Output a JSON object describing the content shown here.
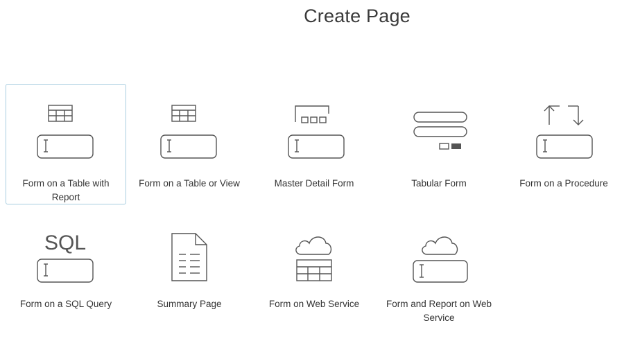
{
  "page": {
    "title": "Create Page"
  },
  "tiles": [
    {
      "label": "Form on a Table with Report",
      "icon": "form-table-report-icon",
      "selected": true
    },
    {
      "label": "Form on a Table or View",
      "icon": "form-table-view-icon"
    },
    {
      "label": "Master Detail Form",
      "icon": "master-detail-icon"
    },
    {
      "label": "Tabular Form",
      "icon": "tabular-form-icon"
    },
    {
      "label": "Form on a Procedure",
      "icon": "procedure-icon"
    },
    {
      "label": "Form on a SQL Query",
      "icon": "sql-query-icon",
      "icon_text": "SQL"
    },
    {
      "label": "Summary Page",
      "icon": "summary-document-icon"
    },
    {
      "label": "Form on Web Service",
      "icon": "web-service-cloud-table-icon"
    },
    {
      "label": "Form and Report on Web Service",
      "icon": "web-service-cloud-form-icon"
    }
  ],
  "colors": {
    "icon_stroke": "#555555",
    "selected_border": "#a8cde0",
    "text": "#333333"
  }
}
